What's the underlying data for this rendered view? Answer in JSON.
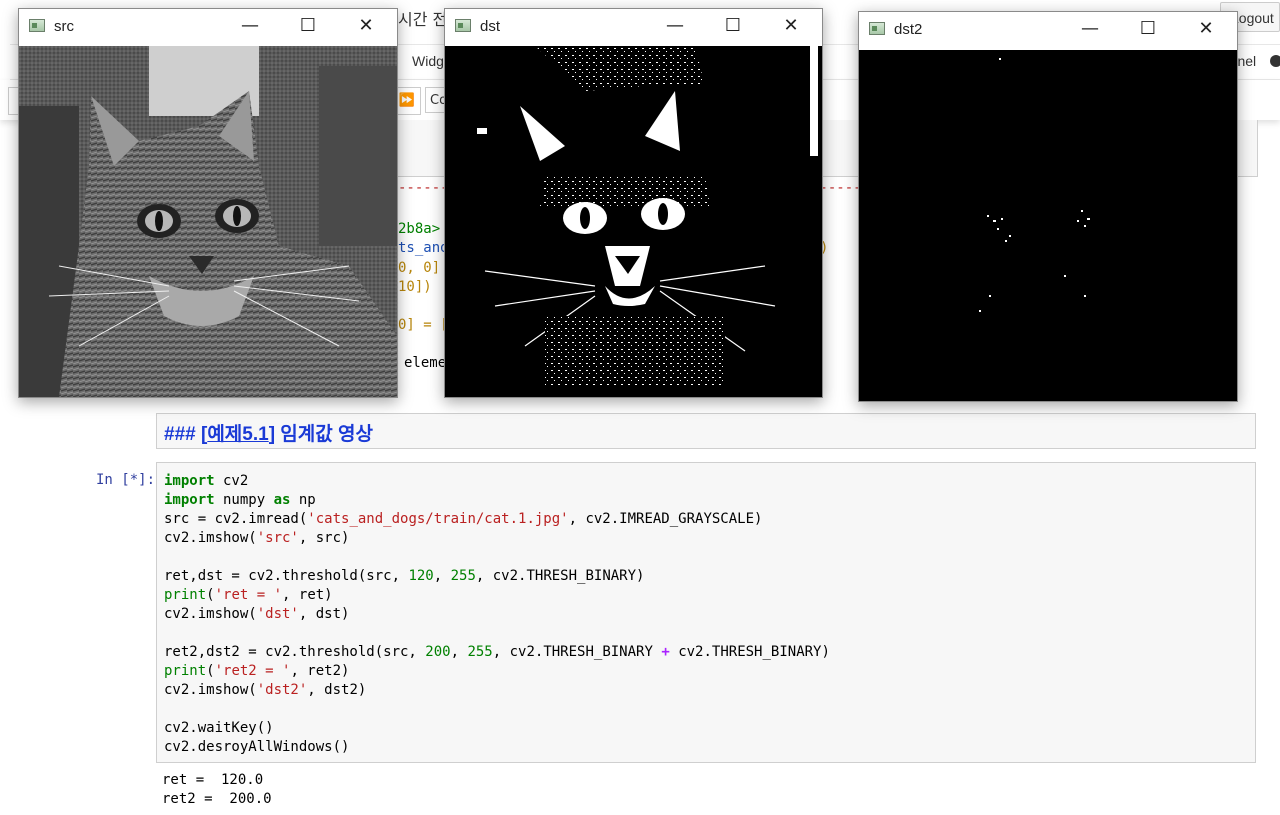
{
  "jupyter": {
    "title_fragment": "시간 전",
    "logout": "Logout",
    "menu_widgets": "Widg",
    "kernel": "ernel",
    "cell_type_fragment": "Co",
    "peek": {
      "line1": "2b8a>",
      "line2": "ts_and",
      "line2_end": ")",
      "line3": "0, 0]",
      "line4": "10])",
      "line5": "0] = [",
      "line6": "eleme"
    }
  },
  "windows": [
    {
      "id": "src",
      "title": "src"
    },
    {
      "id": "dst",
      "title": "dst"
    },
    {
      "id": "dst2",
      "title": "dst2"
    }
  ],
  "window_controls": {
    "minimize": "—",
    "maximize": "☐",
    "close": "✕"
  },
  "markdown": {
    "prefix": "### [",
    "link": "예제5.1",
    "suffix": "] 임계값 영상"
  },
  "code_cell": {
    "prompt": "In [*]:",
    "lines": [
      [
        [
          "kw",
          "import"
        ],
        [
          "t",
          " cv2"
        ]
      ],
      [
        [
          "kw",
          "import"
        ],
        [
          "t",
          " numpy "
        ],
        [
          "kw",
          "as"
        ],
        [
          "t",
          " np"
        ]
      ],
      [
        [
          "t",
          "src = cv2.imread("
        ],
        [
          "str",
          "'cats_and_dogs/train/cat.1.jpg'"
        ],
        [
          "t",
          ", cv2.IMREAD_GRAYSCALE)"
        ]
      ],
      [
        [
          "t",
          "cv2.imshow("
        ],
        [
          "str",
          "'src'"
        ],
        [
          "t",
          ", src)"
        ]
      ],
      [],
      [
        [
          "t",
          "ret,dst = cv2.threshold(src, "
        ],
        [
          "num",
          "120"
        ],
        [
          "t",
          ", "
        ],
        [
          "num",
          "255"
        ],
        [
          "t",
          ", cv2.THRESH_BINARY)"
        ]
      ],
      [
        [
          "bi",
          "print"
        ],
        [
          "t",
          "("
        ],
        [
          "str",
          "'ret = '"
        ],
        [
          "t",
          ", ret)"
        ]
      ],
      [
        [
          "t",
          "cv2.imshow("
        ],
        [
          "str",
          "'dst'"
        ],
        [
          "t",
          ", dst)"
        ]
      ],
      [],
      [
        [
          "t",
          "ret2,dst2 = cv2.threshold(src, "
        ],
        [
          "num",
          "200"
        ],
        [
          "t",
          ", "
        ],
        [
          "num",
          "255"
        ],
        [
          "t",
          ", cv2.THRESH_BINARY "
        ],
        [
          "op",
          "+"
        ],
        [
          "t",
          " cv2.THRESH_BINARY)"
        ]
      ],
      [
        [
          "bi",
          "print"
        ],
        [
          "t",
          "("
        ],
        [
          "str",
          "'ret2 = '"
        ],
        [
          "t",
          ", ret2)"
        ]
      ],
      [
        [
          "t",
          "cv2.imshow("
        ],
        [
          "str",
          "'dst2'"
        ],
        [
          "t",
          ", dst2)"
        ]
      ],
      [],
      [
        [
          "t",
          "cv2.waitKey()"
        ]
      ],
      [
        [
          "t",
          "cv2.desroyAllWindows()"
        ]
      ]
    ]
  },
  "output": {
    "line1": "ret =  120.0",
    "line2": "ret2 =  200.0"
  }
}
